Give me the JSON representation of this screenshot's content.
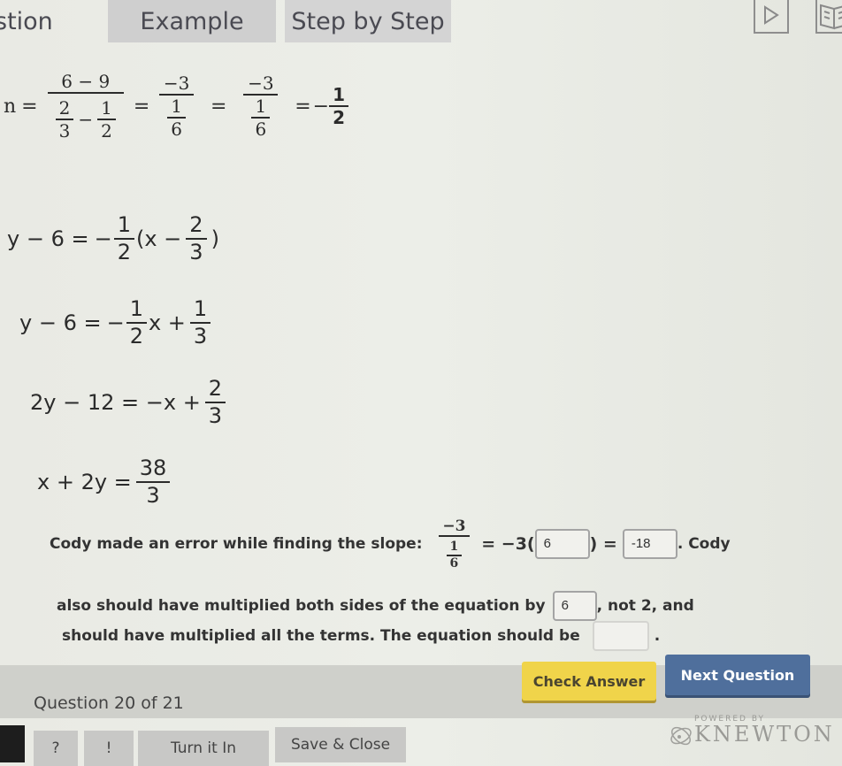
{
  "tabs": [
    {
      "label": "stion"
    },
    {
      "label": "Example"
    },
    {
      "label": "Step by Step"
    }
  ],
  "icons": {
    "play": "play-icon",
    "book": "book-icon"
  },
  "steps": {
    "slope": {
      "lhs": "n",
      "f1_num": "6 − 9",
      "f1_den_a_num": "2",
      "f1_den_a_den": "3",
      "f1_den_op": "−",
      "f1_den_b_num": "1",
      "f1_den_b_den": "2",
      "f2_num": "−3",
      "f2_den_num": "1",
      "f2_den_den": "6",
      "f3_num": "−3",
      "f3_den_num": "1",
      "f3_den_den": "6",
      "result_sign": "−",
      "result_num": "1",
      "result_den": "2"
    },
    "line1": {
      "lhs": "y − 6 =",
      "sign": "−",
      "f_num": "1",
      "f_den": "2",
      "mid": "(x −",
      "g_num": "2",
      "g_den": "3",
      "end": ")"
    },
    "line2": {
      "lhs": "y − 6 =",
      "sign": "−",
      "f_num": "1",
      "f_den": "2",
      "mid": "x +",
      "g_num": "1",
      "g_den": "3"
    },
    "line3": {
      "lhs": "2y − 12 = −x +",
      "g_num": "2",
      "g_den": "3"
    },
    "line4": {
      "lhs": "x + 2y =",
      "g_num": "38",
      "g_den": "3"
    }
  },
  "prompt": {
    "line1_text": "Cody made an error while finding the slope:",
    "frac_num": "−3",
    "frac_den_num": "1",
    "frac_den_den": "6",
    "eq1": "= −3(",
    "eq2": ") =",
    "box1_value": "6",
    "box2_value": "-18",
    "line1_end": ". Cody",
    "line2_text": "also should have multiplied both sides of the equation by",
    "box3_value": "6",
    "line2_end": ", not 2, and",
    "line3_text": "should have multiplied all the terms. The equation should be",
    "box4_value": "",
    "line3_end": "."
  },
  "footer": {
    "question_counter": "Question 20 of 21",
    "check_answer": "Check Answer",
    "next_question": "Next Question",
    "help": "?",
    "hint": "!",
    "turn_in": "Turn it In",
    "save_close": "Save & Close",
    "powered_by": "POWERED BY",
    "brand": "KNEWTON"
  },
  "colors": {
    "check": "#f0d44a",
    "next": "#4f6f9c"
  }
}
